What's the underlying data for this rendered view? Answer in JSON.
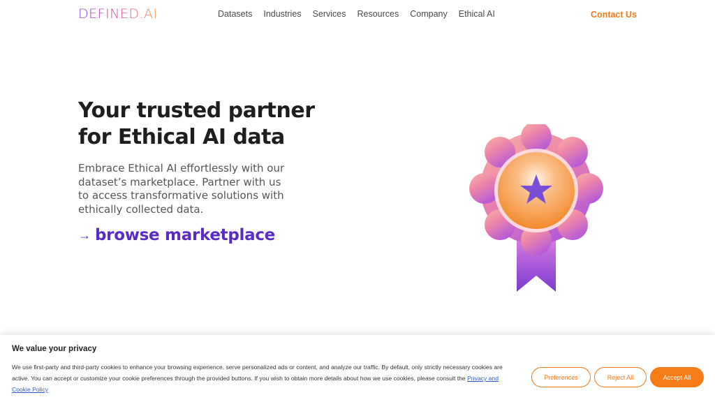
{
  "header": {
    "logo_text": "DEFINED.AI",
    "nav": [
      "Datasets",
      "Industries",
      "Services",
      "Resources",
      "Company",
      "Ethical AI"
    ],
    "contact_label": "Contact Us"
  },
  "hero": {
    "title_line1": "Your trusted partner",
    "title_line2": "for Ethical AI data",
    "description": "Embrace Ethical AI effortlessly with our dataset’s marketplace. Partner with us to access transformative solutions with ethically collected data.",
    "cta_arrow": "→",
    "cta_label": "browse marketplace"
  },
  "badge": {
    "icon": "award-ribbon-icon",
    "colors": {
      "petal_start": "#f5a3a0",
      "petal_end": "#b656d6",
      "center": "#f79a3a",
      "star": "#7a4fd8",
      "ribbon": "#8a3fd6"
    }
  },
  "cookie": {
    "title": "We value your privacy",
    "body": "We use first-party and third-party cookies to enhance your browsing experience, serve personalized ads or content, and analyze our traffic. By default, only strictly necessary cookies are active. You can accept or customize your cookie preferences through the provided buttons. If you wish to obtain more details about how we use cookies, please consult the ",
    "link_label": "Privacy and Cookie Policy",
    "preferences_label": "Preferences",
    "reject_label": "Reject All",
    "accept_label": "Accept All"
  },
  "colors": {
    "accent_orange": "#f07a1a",
    "accent_purple": "#5b2bc8"
  }
}
